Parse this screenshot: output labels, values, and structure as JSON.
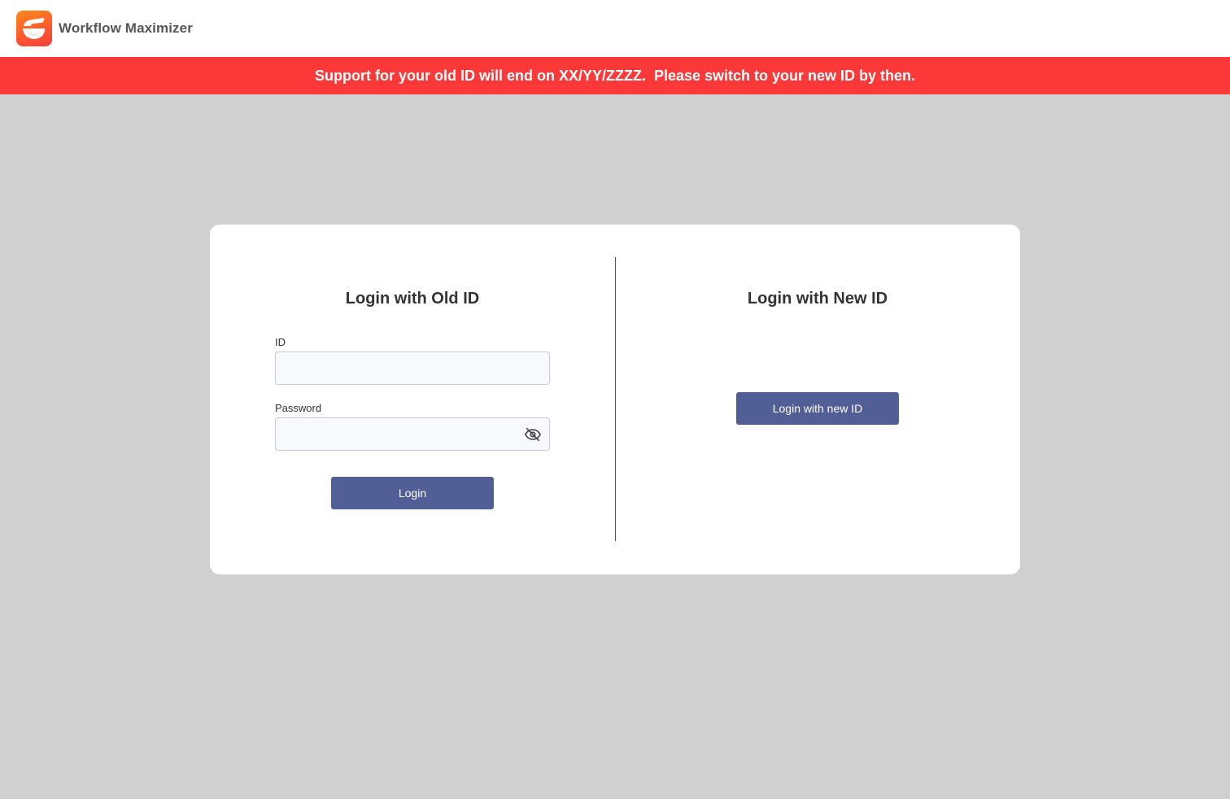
{
  "header": {
    "app_name": "Workflow Maximizer",
    "logo_icon": "app-logo-icon"
  },
  "banner": {
    "message": "Support for your old ID will end on XX/YY/ZZZZ.  Please switch to your new ID by then.",
    "color": "#fc3838"
  },
  "old_login": {
    "title": "Login with Old ID",
    "id_label": "ID",
    "id_value": "",
    "password_label": "Password",
    "password_value": "",
    "password_toggle_icon": "eye-off-icon",
    "login_button": "Login"
  },
  "new_login": {
    "title": "Login with New ID",
    "login_button": "Login with new ID"
  },
  "colors": {
    "button": "#525f96",
    "background": "#d0d0d0",
    "banner": "#fc3838"
  }
}
